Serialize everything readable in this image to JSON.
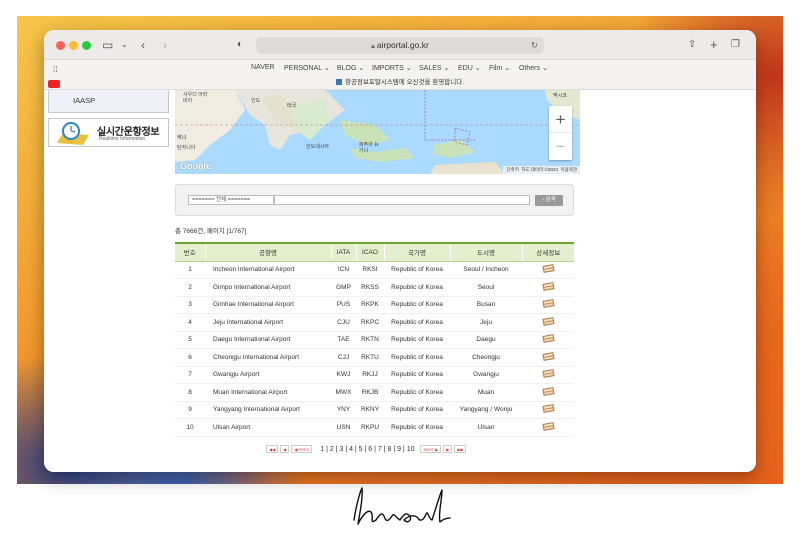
{
  "browser": {
    "url": "airportal.go.kr",
    "bookmarks": [
      "NAVER",
      "PERSONAL",
      "BLOG",
      "IMPORTS",
      "SALES",
      "EDU",
      "Film",
      "Others"
    ],
    "notice": "항공정보포탈시스템에 오신것을 환영합니다."
  },
  "sidebar": {
    "iaasp_label": "IAASP",
    "live_title": "실시간운항정보",
    "live_subtitle": "Realtime Information"
  },
  "map": {
    "labels": {
      "saudi": "사우디 아라비아",
      "india": "인도",
      "thailand": "태국",
      "kenya": "케냐",
      "tanzania": "탄자니아",
      "indonesia": "인도네시아",
      "png": "파푸아 뉴기니",
      "mexico": "멕시코"
    },
    "footer": {
      "shortcuts": "단축키",
      "map_data": "지도 데이터 ©2023",
      "terms": "이용약관"
    },
    "google": "Google"
  },
  "search": {
    "select_value": "======= 전체 =======",
    "button_label": "› 검색"
  },
  "result_count": "총 7666건, 페이지 [1/767]",
  "table": {
    "headers": [
      "번호",
      "공항명",
      "IATA",
      "ICAO",
      "국가명",
      "도시명",
      "상세정보"
    ],
    "rows": [
      [
        "1",
        "Incheon International Airport",
        "ICN",
        "RKSI",
        "Republic of Korea",
        "Seoul / Incheon"
      ],
      [
        "2",
        "Gimpo International Airport",
        "GMP",
        "RKSS",
        "Republic of Korea",
        "Seoul"
      ],
      [
        "3",
        "Gimhae International Airport",
        "PUS",
        "RKPK",
        "Republic of Korea",
        "Busan"
      ],
      [
        "4",
        "Jeju International Airport",
        "CJU",
        "RKPC",
        "Republic of Korea",
        "Jeju"
      ],
      [
        "5",
        "Daegu International Airport",
        "TAE",
        "RKTN",
        "Republic of Korea",
        "Daegu"
      ],
      [
        "6",
        "Cheongju International Airport",
        "CJJ",
        "RKTU",
        "Republic of Korea",
        "Cheongju"
      ],
      [
        "7",
        "Gwangju Airport",
        "KWJ",
        "RKJJ",
        "Republic of Korea",
        "Gwangju"
      ],
      [
        "8",
        "Muan International Airport",
        "MWX",
        "RKJB",
        "Republic of Korea",
        "Muan"
      ],
      [
        "9",
        "Yangyang International Airport",
        "YNY",
        "RKNY",
        "Republic of Korea",
        "Yangyang / Wonju"
      ],
      [
        "10",
        "Ulsan Airport",
        "USN",
        "RKPU",
        "Republic of Korea",
        "Ulsan"
      ]
    ]
  },
  "pagination": {
    "first": "◀◀",
    "prev10": "◀",
    "prev": "◀ PREV",
    "pages": "1 | 2 | 3 | 4 | 5 | 6 | 7 | 8 | 9 | 10",
    "next": "NEXT ▶",
    "next10": "▶",
    "last": "▶▶"
  },
  "signature": "hiword"
}
